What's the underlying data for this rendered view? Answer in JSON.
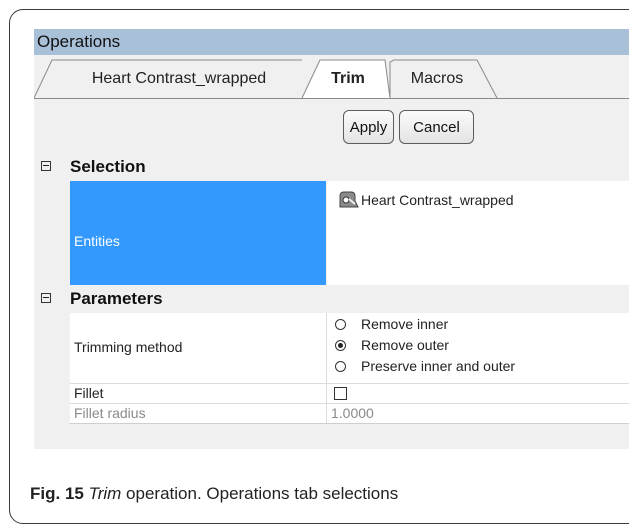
{
  "window": {
    "title": "Operations"
  },
  "tabs": [
    {
      "label": "Heart Contrast_wrapped",
      "active": false
    },
    {
      "label": "Trim",
      "active": true
    },
    {
      "label": "Macros",
      "active": false
    }
  ],
  "toolbar": {
    "apply_label": "Apply",
    "cancel_label": "Cancel"
  },
  "sections": {
    "selection": {
      "header": "Selection",
      "entities_label": "Entities",
      "entities_value": "Heart Contrast_wrapped",
      "entities_icon": "mesh-object-icon"
    },
    "parameters": {
      "header": "Parameters",
      "trimming_method_label": "Trimming method",
      "trimming_options": [
        {
          "label": "Remove inner",
          "selected": false
        },
        {
          "label": "Remove outer",
          "selected": true
        },
        {
          "label": "Preserve inner and outer",
          "selected": false
        }
      ],
      "fillet_label": "Fillet",
      "fillet_checked": false,
      "fillet_radius_label": "Fillet radius",
      "fillet_radius_value": "1.0000"
    }
  },
  "caption": {
    "fig": "Fig. 15",
    "italic": "Trim",
    "rest": " operation. Operations tab selections"
  },
  "colors": {
    "titlebar": "#a9c0d9",
    "selected_cell": "#3399ff"
  }
}
